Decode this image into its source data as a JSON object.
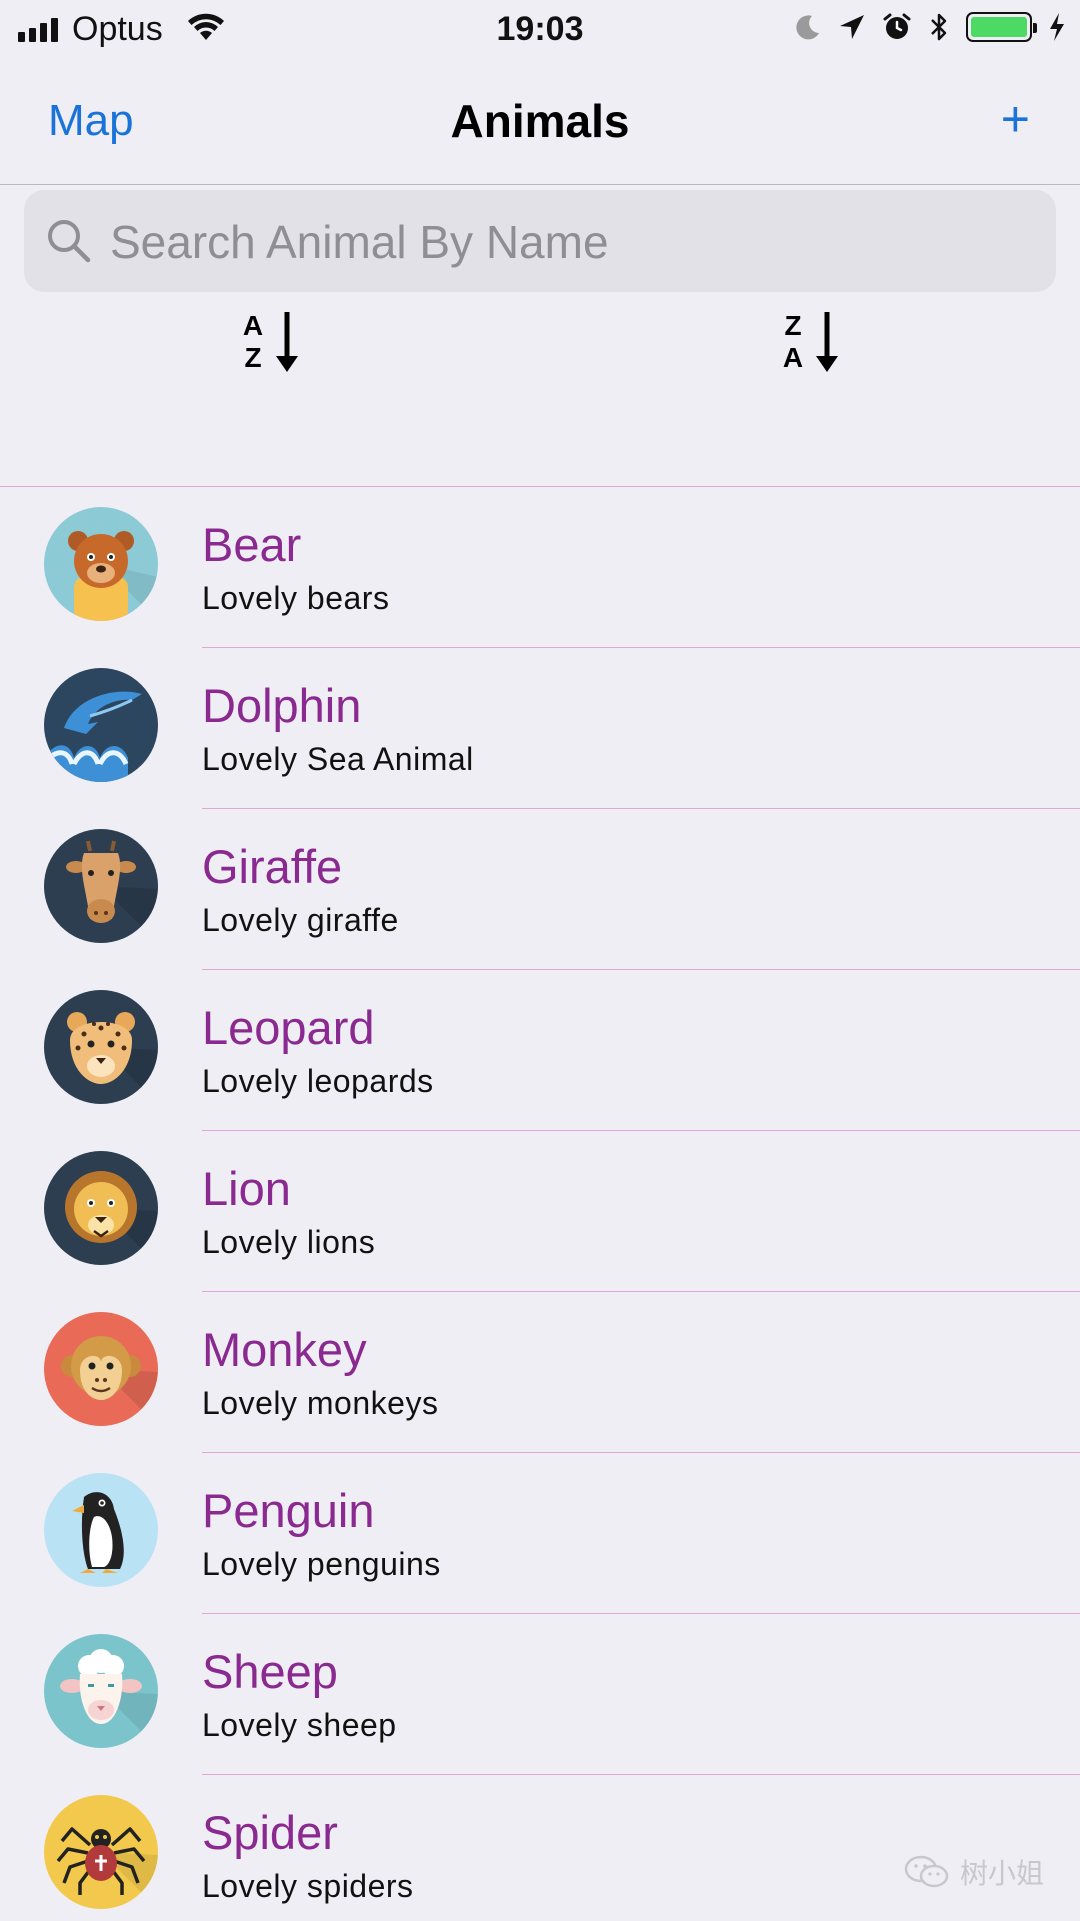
{
  "status_bar": {
    "carrier": "Optus",
    "time": "19:03",
    "battery_level": 1.0,
    "battery_color": "#4cd964"
  },
  "nav": {
    "left_label": "Map",
    "title": "Animals",
    "right_label": "+"
  },
  "search": {
    "placeholder": "Search Animal By Name",
    "value": ""
  },
  "sort": {
    "ascending": {
      "top": "A",
      "bottom": "Z"
    },
    "descending": {
      "top": "Z",
      "bottom": "A"
    }
  },
  "animals": [
    {
      "name": "Bear",
      "subtitle": "Lovely bears",
      "icon": "bear-icon",
      "bg": "#8ccbd6"
    },
    {
      "name": "Dolphin",
      "subtitle": "Lovely Sea Animal",
      "icon": "dolphin-icon",
      "bg": "#2d4660"
    },
    {
      "name": "Giraffe",
      "subtitle": "Lovely giraffe",
      "icon": "giraffe-icon",
      "bg": "#2c3e50"
    },
    {
      "name": "Leopard",
      "subtitle": "Lovely leopards",
      "icon": "leopard-icon",
      "bg": "#2c3e50"
    },
    {
      "name": "Lion",
      "subtitle": "Lovely lions",
      "icon": "lion-icon",
      "bg": "#2c3e50"
    },
    {
      "name": "Monkey",
      "subtitle": "Lovely monkeys",
      "icon": "monkey-icon",
      "bg": "#e86a57"
    },
    {
      "name": "Penguin",
      "subtitle": "Lovely penguins",
      "icon": "penguin-icon",
      "bg": "#b9e3f5"
    },
    {
      "name": "Sheep",
      "subtitle": "Lovely sheep",
      "icon": "sheep-icon",
      "bg": "#7cc4cc"
    },
    {
      "name": "Spider",
      "subtitle": "Lovely spiders",
      "icon": "spider-icon",
      "bg": "#f2c94c"
    }
  ],
  "watermark": "树小姐",
  "colors": {
    "accent": "#1a73d9",
    "animal_name": "#8a2a91",
    "separator": "#e0a6d8",
    "background": "#efeef4"
  }
}
